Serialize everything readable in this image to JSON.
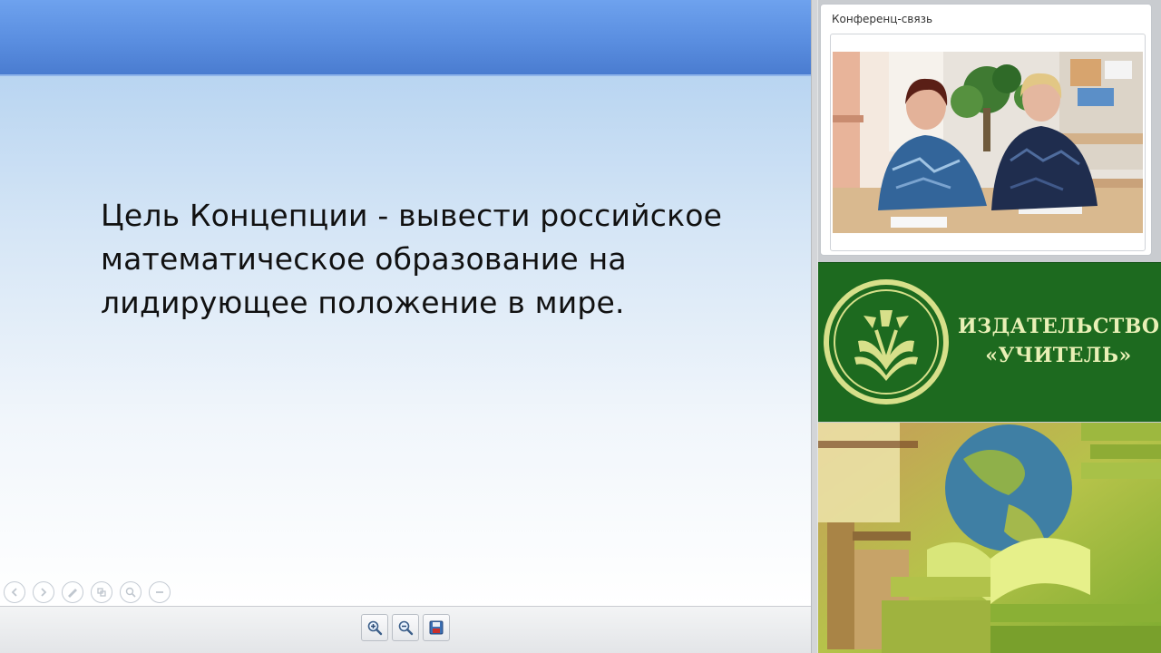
{
  "slide": {
    "text": "Цель Концепции - вывести российское математическое образование на лидирующее положение в мире.",
    "nav_icons": [
      "prev-icon",
      "next-icon",
      "pen-icon",
      "slides-icon",
      "zoom-icon",
      "minus-icon"
    ]
  },
  "toolbar": {
    "icons": [
      "zoom-in-icon",
      "zoom-out-icon",
      "save-icon"
    ]
  },
  "conference": {
    "title": "Конференц-связь"
  },
  "banner": {
    "line1": "ИЗДАТЕЛЬСТВО",
    "line2": "«УЧИТЕЛЬ»",
    "colors": {
      "background": "#1d6a1f",
      "text": "#e9f0b6"
    }
  },
  "colors": {
    "slide_header": "#5a8ee0",
    "slide_body_top": "#b9d5f1",
    "toolbar_bg": "#e8e9eb"
  }
}
